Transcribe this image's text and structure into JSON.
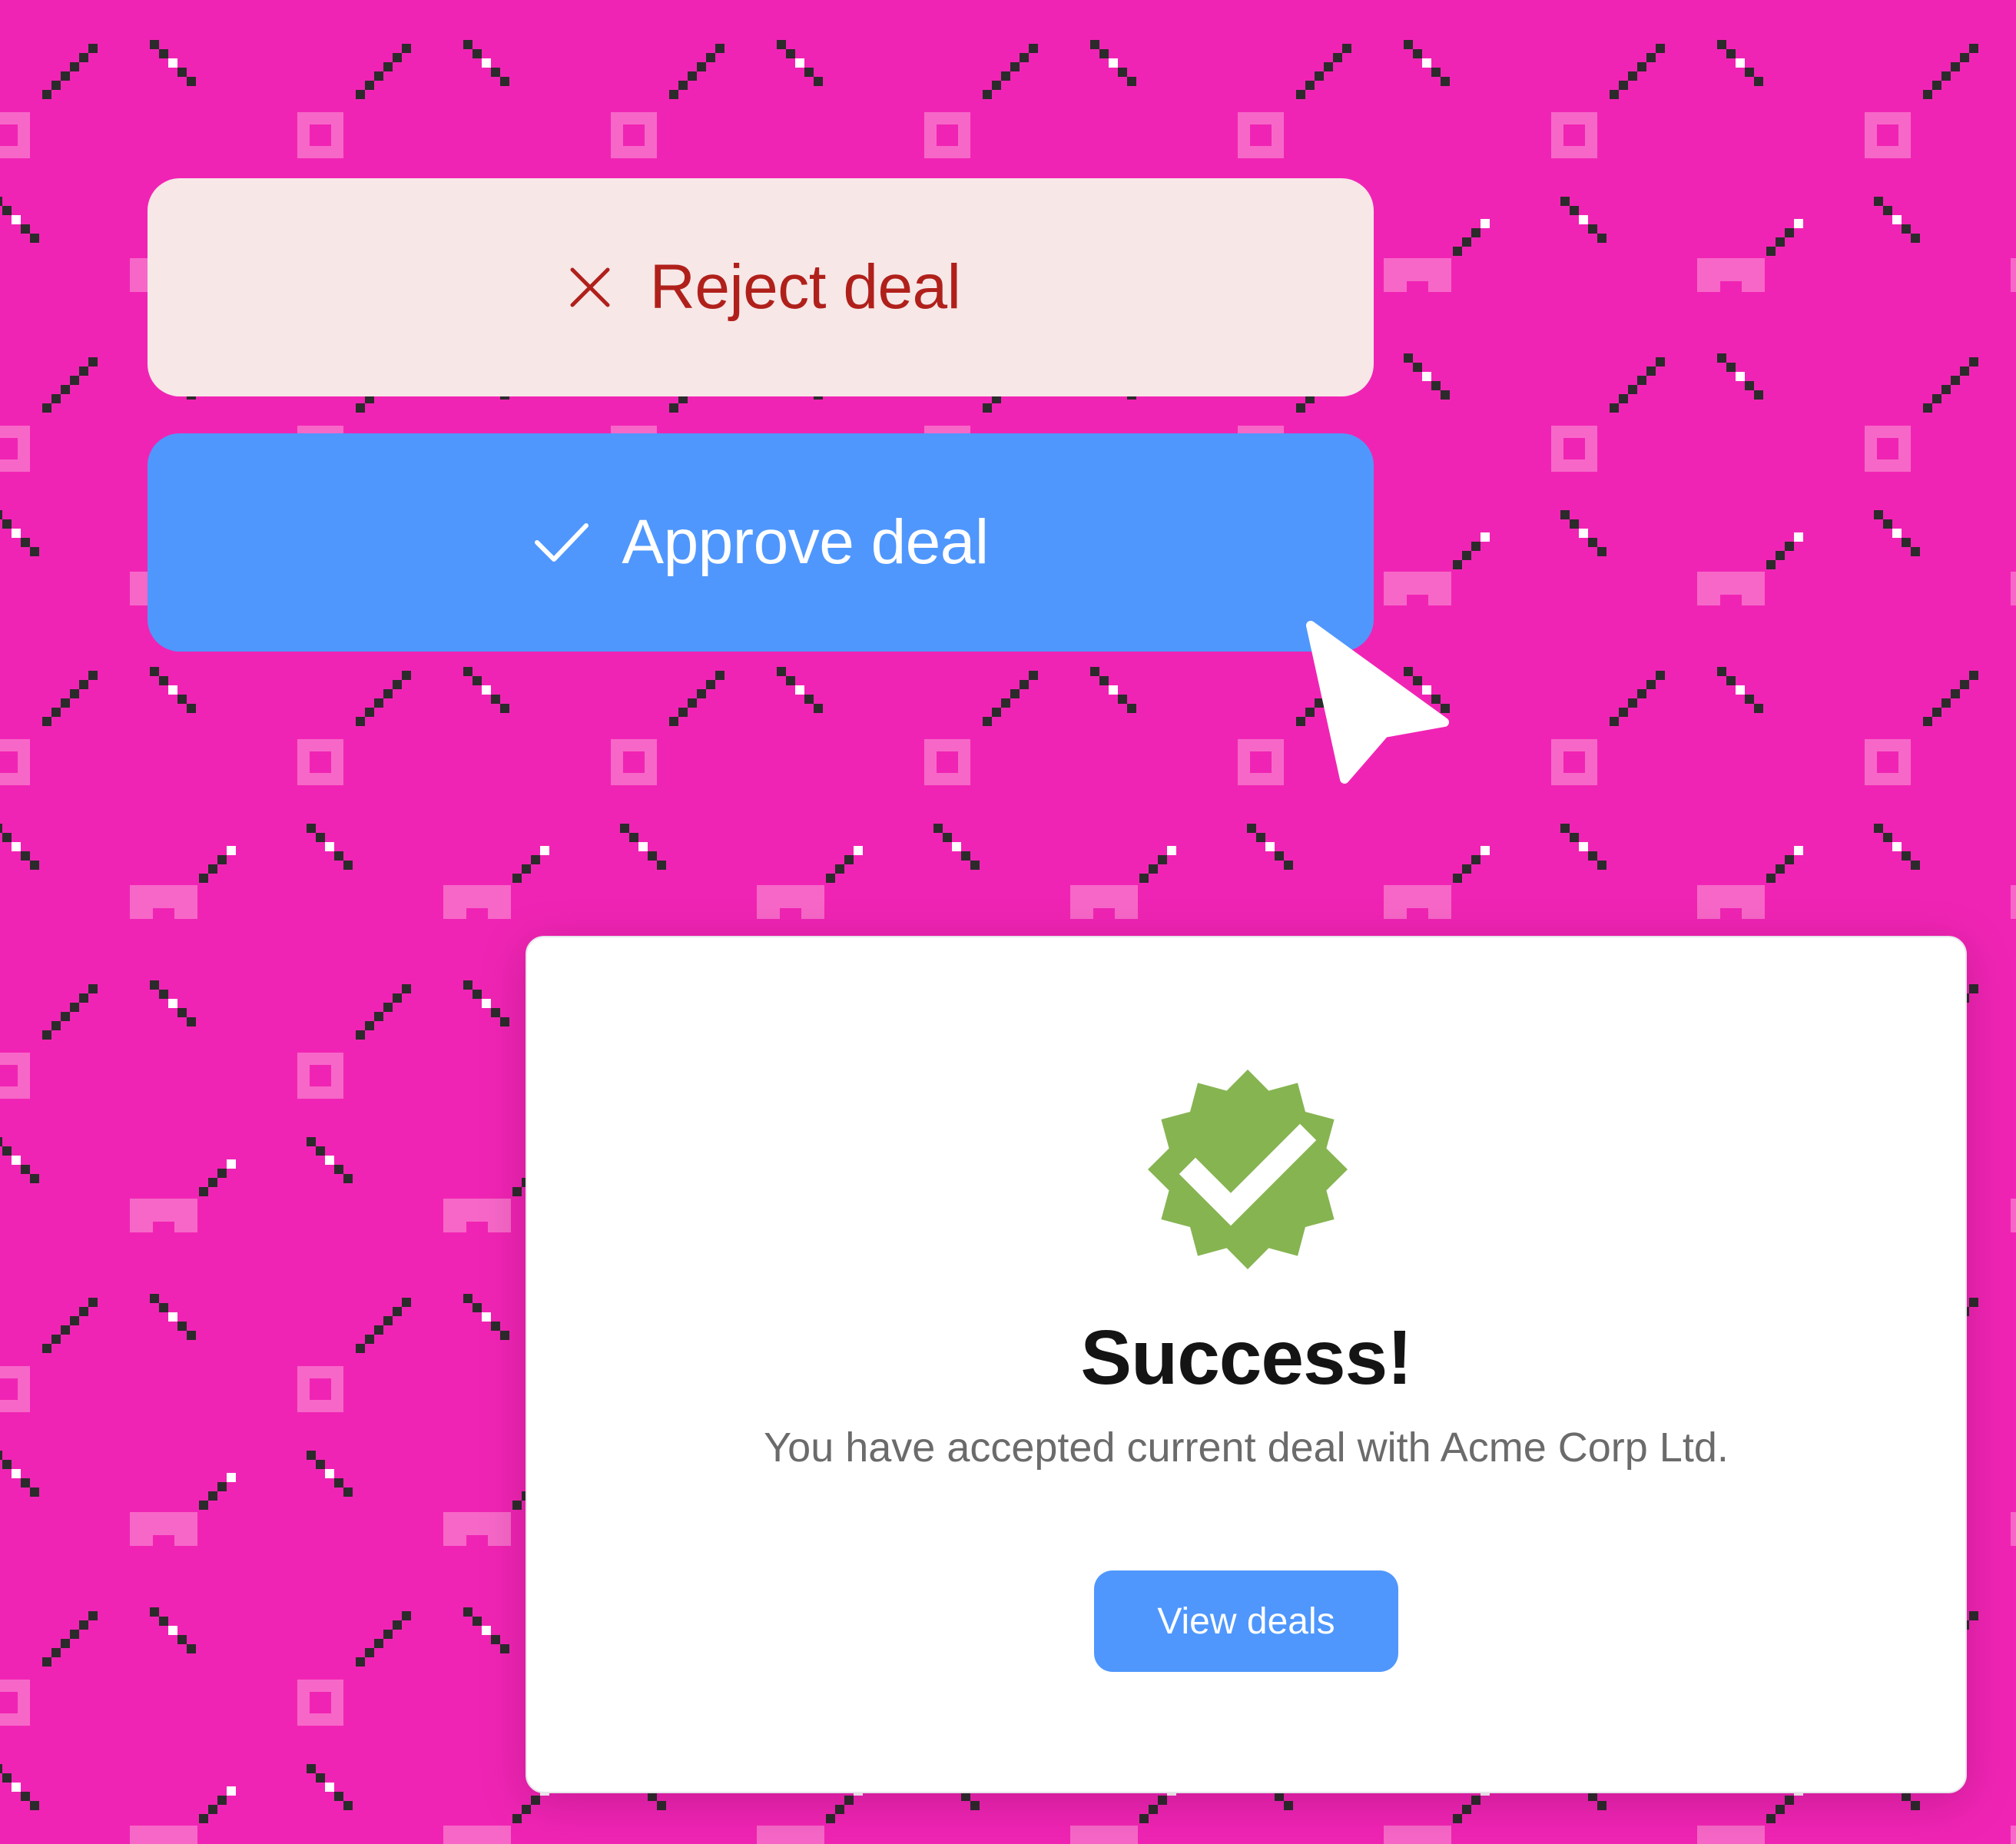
{
  "actions": {
    "reject_label": "Reject deal",
    "approve_label": "Approve deal"
  },
  "modal": {
    "title": "Success!",
    "message": "You have accepted current deal with Acme Corp Ltd.",
    "button_label": "View deals"
  },
  "icons": {
    "reject": "close-icon",
    "approve": "checkmark-icon",
    "success": "verified-badge-icon",
    "pointer": "mouse-pointer-icon"
  },
  "colors": {
    "background": "#f024b4",
    "pattern_ring": "#f767c8",
    "pattern_dark": "#2b2b2b",
    "reject_bg": "#f7e7e7",
    "reject_text": "#b0201b",
    "primary": "#4f97fd",
    "success_green": "#86b451",
    "title_text": "#141414",
    "body_text": "#6b6b6b"
  }
}
